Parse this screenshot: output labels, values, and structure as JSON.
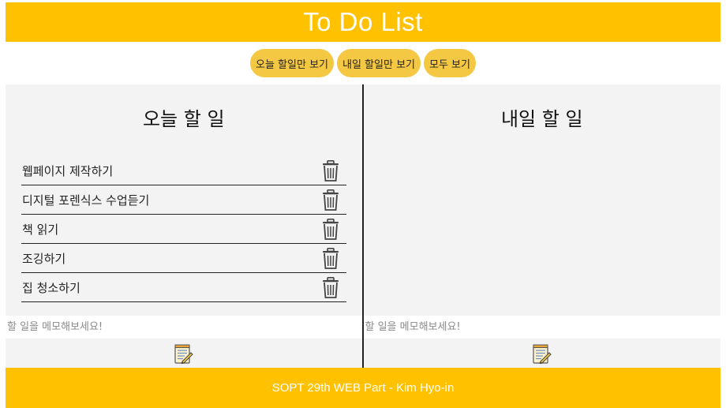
{
  "header": {
    "title": "To Do List"
  },
  "filters": [
    {
      "label": "오늘 할일만 보기"
    },
    {
      "label": "내일 할일만 보기"
    },
    {
      "label": "모두 보기"
    }
  ],
  "today": {
    "title": "오늘 할 일",
    "items": [
      {
        "text": "웹페이지 제작하기",
        "icon": "trash-icon"
      },
      {
        "text": "디지털 포렌식스 수업듣기",
        "icon": "trash-icon"
      },
      {
        "text": "책 읽기",
        "icon": "trash-icon"
      },
      {
        "text": "조깅하기",
        "icon": "trash-icon"
      },
      {
        "text": "집 청소하기",
        "icon": "trash-icon"
      }
    ],
    "input_placeholder": "할 일을 메모해보세요!",
    "add_icon": "memo-edit-icon"
  },
  "tomorrow": {
    "title": "내일 할 일",
    "items": [],
    "input_placeholder": "할 일을 메모해보세요!",
    "add_icon": "memo-edit-icon"
  },
  "footer": {
    "text": "SOPT 29th WEB Part - Kim Hyo-in"
  },
  "colors": {
    "accent": "#ffc100",
    "button": "#f4c842",
    "panel": "#f3f3f3"
  }
}
